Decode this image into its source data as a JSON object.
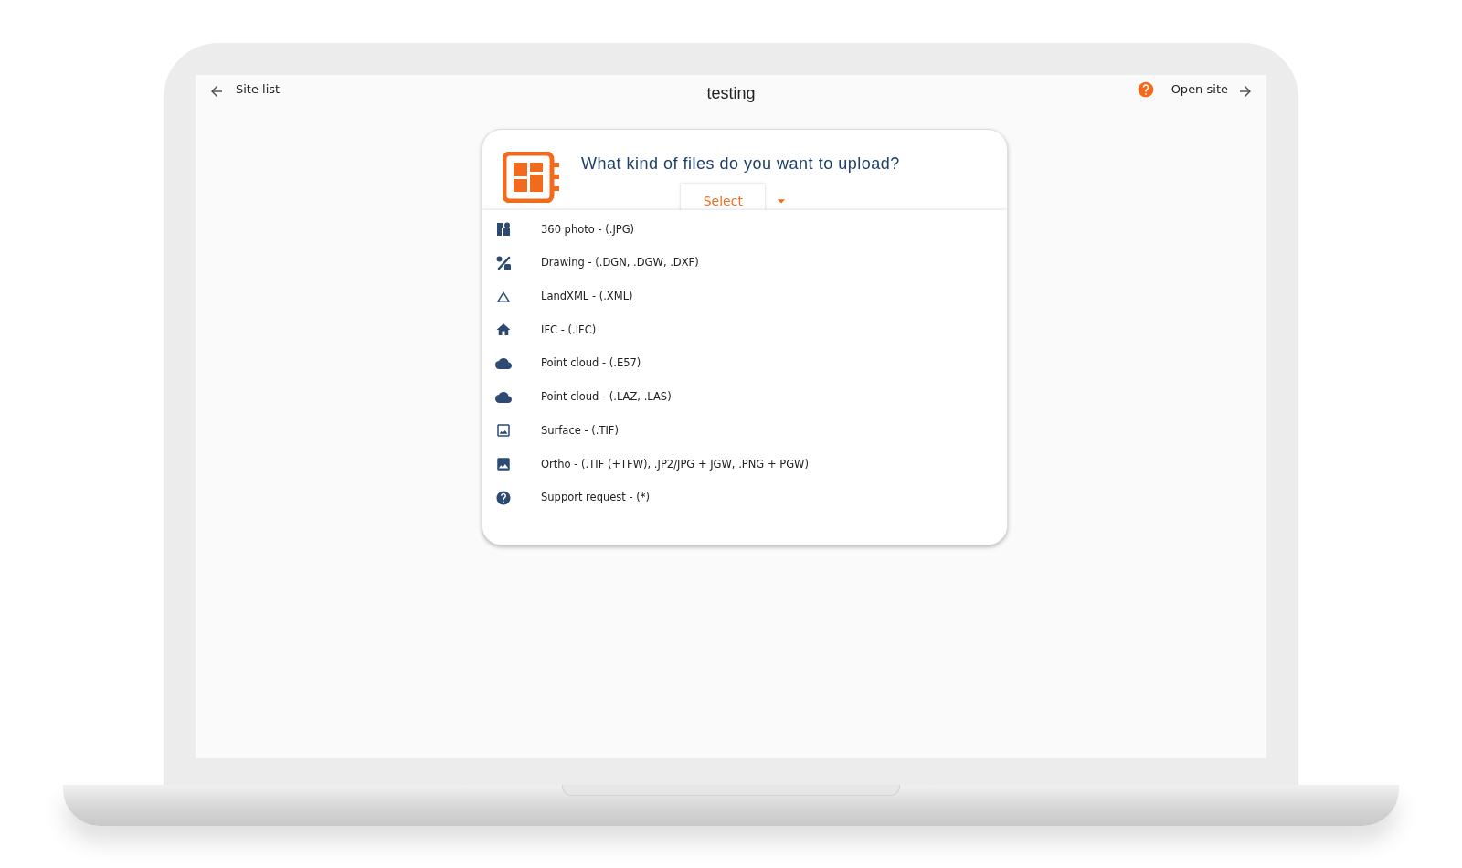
{
  "header": {
    "back_link": "Site list",
    "title": "testing",
    "open_link": "Open site"
  },
  "upload_card": {
    "question": "What kind of files do you want to upload?",
    "select": {
      "value": "Select",
      "expanded": true
    },
    "options": [
      {
        "kind": "photo360",
        "label": "360 photo - (.JPG)"
      },
      {
        "kind": "drawing",
        "label": "Drawing - (.DGN, .DGW, .DXF)"
      },
      {
        "kind": "landxml",
        "label": "LandXML - (.XML)"
      },
      {
        "kind": "ifc",
        "label": "IFC - (.IFC)"
      },
      {
        "kind": "pointcloud",
        "label": "Point cloud - (.E57)"
      },
      {
        "kind": "pointcloud",
        "label": "Point cloud - (.LAZ, .LAS)"
      },
      {
        "kind": "surface",
        "label": "Surface - (.TIF)"
      },
      {
        "kind": "ortho",
        "label": "Ortho - (.TIF (+TFW), .JP2/JPG + JGW, .PNG + PGW)"
      },
      {
        "kind": "support",
        "label": "Support request - (*)"
      }
    ]
  }
}
